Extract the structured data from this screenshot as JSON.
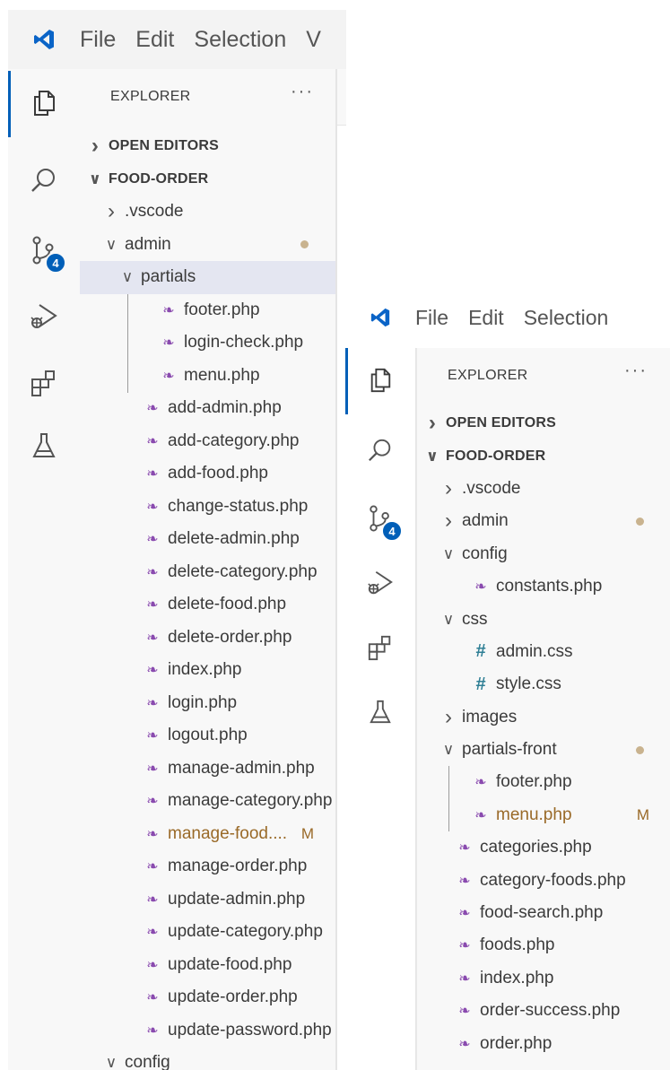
{
  "menu": [
    "File",
    "Edit",
    "Selection",
    "V"
  ],
  "menu2": [
    "File",
    "Edit",
    "Selection"
  ],
  "explorer": {
    "title": "EXPLORER",
    "more": "···"
  },
  "badge": "4",
  "colors": {
    "accent": "#005fb8",
    "php": "#8a4baf",
    "css": "#2f7f95",
    "modified": "#9a6a28",
    "selected": "#e4e6f1"
  },
  "left_tree": [
    {
      "label": "OPEN EDITORS",
      "depth": 0,
      "kind": "section",
      "chev": "right"
    },
    {
      "label": "FOOD-ORDER",
      "depth": 0,
      "kind": "section",
      "chev": "down"
    },
    {
      "label": ".vscode",
      "depth": 1,
      "kind": "folder",
      "chev": "right"
    },
    {
      "label": "admin",
      "depth": 1,
      "kind": "folder",
      "chev": "down",
      "dot": true
    },
    {
      "label": "partials",
      "depth": 2,
      "kind": "folder",
      "chev": "down",
      "selected": true
    },
    {
      "label": "footer.php",
      "depth": 3,
      "kind": "php"
    },
    {
      "label": "login-check.php",
      "depth": 3,
      "kind": "php"
    },
    {
      "label": "menu.php",
      "depth": 3,
      "kind": "php"
    },
    {
      "label": "add-admin.php",
      "depth": 2,
      "kind": "php"
    },
    {
      "label": "add-category.php",
      "depth": 2,
      "kind": "php"
    },
    {
      "label": "add-food.php",
      "depth": 2,
      "kind": "php"
    },
    {
      "label": "change-status.php",
      "depth": 2,
      "kind": "php"
    },
    {
      "label": "delete-admin.php",
      "depth": 2,
      "kind": "php"
    },
    {
      "label": "delete-category.php",
      "depth": 2,
      "kind": "php"
    },
    {
      "label": "delete-food.php",
      "depth": 2,
      "kind": "php"
    },
    {
      "label": "delete-order.php",
      "depth": 2,
      "kind": "php"
    },
    {
      "label": "index.php",
      "depth": 2,
      "kind": "php"
    },
    {
      "label": "login.php",
      "depth": 2,
      "kind": "php"
    },
    {
      "label": "logout.php",
      "depth": 2,
      "kind": "php"
    },
    {
      "label": "manage-admin.php",
      "depth": 2,
      "kind": "php"
    },
    {
      "label": "manage-category.php",
      "depth": 2,
      "kind": "php"
    },
    {
      "label": "manage-food....",
      "depth": 2,
      "kind": "php",
      "modified": "M"
    },
    {
      "label": "manage-order.php",
      "depth": 2,
      "kind": "php"
    },
    {
      "label": "update-admin.php",
      "depth": 2,
      "kind": "php"
    },
    {
      "label": "update-category.php",
      "depth": 2,
      "kind": "php"
    },
    {
      "label": "update-food.php",
      "depth": 2,
      "kind": "php"
    },
    {
      "label": "update-order.php",
      "depth": 2,
      "kind": "php"
    },
    {
      "label": "update-password.php",
      "depth": 2,
      "kind": "php"
    },
    {
      "label": "config",
      "depth": 1,
      "kind": "folder",
      "chev": "down"
    }
  ],
  "right_tree": [
    {
      "label": "OPEN EDITORS",
      "depth": 0,
      "kind": "section",
      "chev": "right"
    },
    {
      "label": "FOOD-ORDER",
      "depth": 0,
      "kind": "section",
      "chev": "down"
    },
    {
      "label": ".vscode",
      "depth": 1,
      "kind": "folder",
      "chev": "right"
    },
    {
      "label": "admin",
      "depth": 1,
      "kind": "folder",
      "chev": "right",
      "dot": true
    },
    {
      "label": "config",
      "depth": 1,
      "kind": "folder",
      "chev": "down"
    },
    {
      "label": "constants.php",
      "depth": 2,
      "kind": "php"
    },
    {
      "label": "css",
      "depth": 1,
      "kind": "folder",
      "chev": "down"
    },
    {
      "label": "admin.css",
      "depth": 2,
      "kind": "css"
    },
    {
      "label": "style.css",
      "depth": 2,
      "kind": "css"
    },
    {
      "label": "images",
      "depth": 1,
      "kind": "folder",
      "chev": "right"
    },
    {
      "label": "partials-front",
      "depth": 1,
      "kind": "folder",
      "chev": "down",
      "dot": true
    },
    {
      "label": "footer.php",
      "depth": 2,
      "kind": "php"
    },
    {
      "label": "menu.php",
      "depth": 2,
      "kind": "php",
      "modified": "M"
    },
    {
      "label": "categories.php",
      "depth": 1,
      "kind": "php"
    },
    {
      "label": "category-foods.php",
      "depth": 1,
      "kind": "php"
    },
    {
      "label": "food-search.php",
      "depth": 1,
      "kind": "php"
    },
    {
      "label": "foods.php",
      "depth": 1,
      "kind": "php"
    },
    {
      "label": "index.php",
      "depth": 1,
      "kind": "php"
    },
    {
      "label": "order-success.php",
      "depth": 1,
      "kind": "php"
    },
    {
      "label": "order.php",
      "depth": 1,
      "kind": "php"
    }
  ]
}
